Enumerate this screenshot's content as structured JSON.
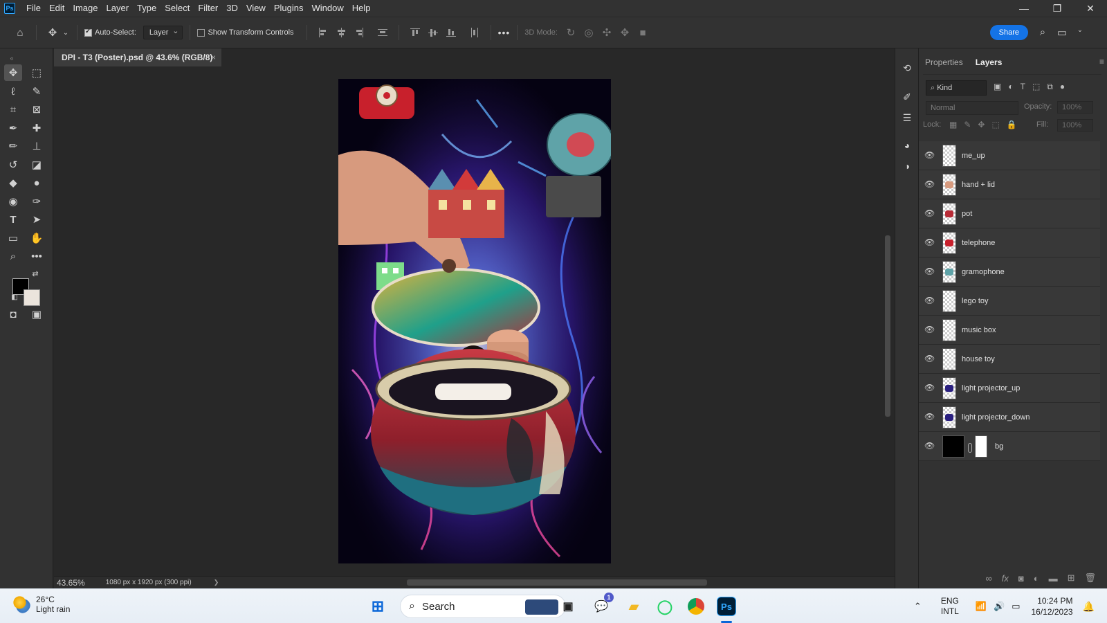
{
  "app": {
    "logo": "Ps",
    "menu": [
      "File",
      "Edit",
      "Image",
      "Layer",
      "Type",
      "Select",
      "Filter",
      "3D",
      "View",
      "Plugins",
      "Window",
      "Help"
    ],
    "window_controls": [
      "—",
      "❐",
      "✕"
    ]
  },
  "options_bar": {
    "auto_select_label": "Auto-Select:",
    "auto_select_checked": true,
    "auto_select_target": "Layer",
    "transform_controls_label": "Show Transform Controls",
    "transform_controls_checked": false,
    "mode_label": "3D Mode:",
    "more_label": "•••",
    "share_label": "Share"
  },
  "document": {
    "tab_title": "DPI - T3 (Poster).psd @ 43.6% (RGB/8)",
    "close": "×"
  },
  "status": {
    "zoom": "43.65%",
    "dimensions": "1080 px x 1920 px (300 ppi)",
    "arrow": "❯"
  },
  "layers_panel": {
    "tabs": [
      "Properties",
      "Layers"
    ],
    "active_tab": "Layers",
    "kind_filter": "Kind",
    "blend_mode": "Normal",
    "opacity_label": "Opacity:",
    "opacity_value": "100%",
    "lock_label": "Lock:",
    "fill_label": "Fill:",
    "fill_value": "100%",
    "layers": [
      {
        "name": "me_up"
      },
      {
        "name": "hand + lid"
      },
      {
        "name": "pot"
      },
      {
        "name": "telephone"
      },
      {
        "name": "gramophone"
      },
      {
        "name": "lego toy"
      },
      {
        "name": "music box"
      },
      {
        "name": "house toy"
      },
      {
        "name": "light projector_up"
      },
      {
        "name": "light projector_down"
      },
      {
        "name": "bg"
      }
    ]
  },
  "taskbar": {
    "temperature": "26°C",
    "weather": "Light rain",
    "search_placeholder": "Search",
    "language_top": "ENG",
    "language_bottom": "INTL",
    "time": "10:24 PM",
    "date": "16/12/2023",
    "teams_badge": "1"
  },
  "colors": {
    "accent": "#1473e6",
    "panel_bg": "#323232",
    "canvas_bg": "#282828",
    "foreground_color": "#000000",
    "background_color": "#ebe4dc"
  }
}
